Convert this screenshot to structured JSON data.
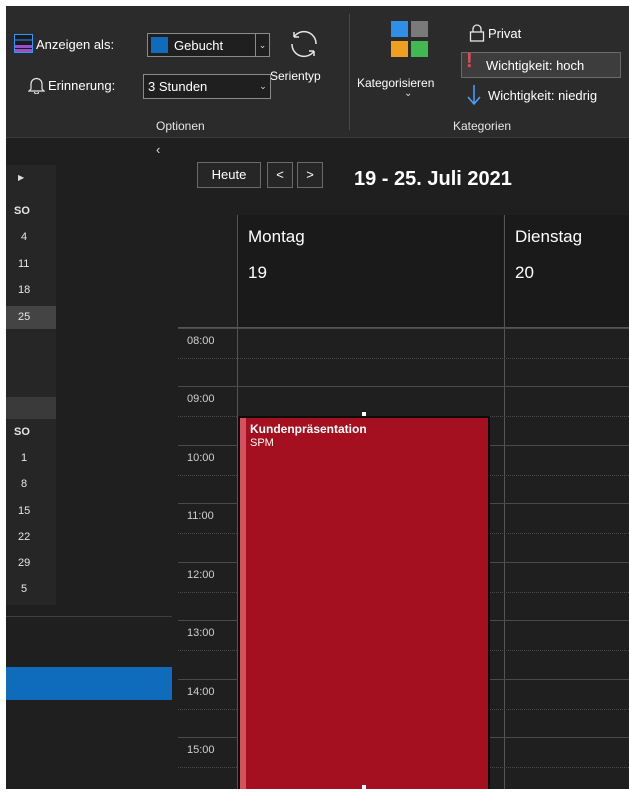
{
  "ribbon": {
    "options": {
      "show_as_label": "Anzeigen als:",
      "show_as_value": "Gebucht",
      "reminder_label": "Erinnerung:",
      "reminder_value": "3 Stunden",
      "recurrence_label": "Serientyp",
      "group_label": "Optionen"
    },
    "categories": {
      "categorize_label": "Kategorisieren",
      "private_label": "Privat",
      "high_importance_label": "Wichtigkeit: hoch",
      "low_importance_label": "Wichtigkeit: niedrig",
      "group_label": "Kategorien"
    }
  },
  "navigation": {
    "day_header": "SO",
    "month1": [
      "4",
      "11",
      "18",
      "25"
    ],
    "month2": [
      "1",
      "8",
      "15",
      "22",
      "29",
      "5"
    ]
  },
  "calendar": {
    "today_label": "Heute",
    "prev_symbol": "<",
    "next_symbol": ">",
    "date_range": "19 - 25. Juli 2021",
    "days": [
      {
        "name": "Montag",
        "number": "19"
      },
      {
        "name": "Dienstag",
        "number": "20"
      }
    ],
    "times": [
      "08:00",
      "09:00",
      "10:00",
      "11:00",
      "12:00",
      "13:00",
      "14:00",
      "15:00"
    ],
    "event": {
      "title": "Kundenpräsentation",
      "location": "SPM"
    }
  },
  "colors": {
    "event": "#a4101f",
    "accent": "#0f6cbd",
    "importance_high": "#e74856",
    "importance_low": "#4aa3ff"
  }
}
